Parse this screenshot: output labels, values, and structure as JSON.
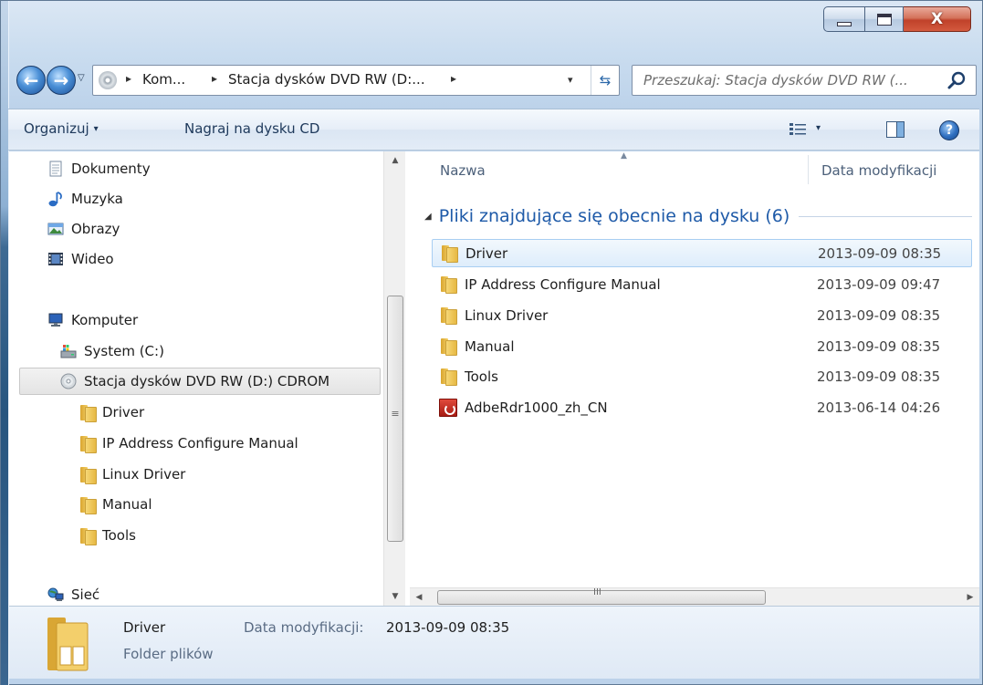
{
  "window": {
    "close_glyph": "X"
  },
  "nav": {
    "back_glyph": "←",
    "forward_glyph": "→",
    "history_caret": "▽"
  },
  "address": {
    "segments": [
      "Kom...",
      "Stacja dysków DVD RW (D:..."
    ],
    "separator": "▸",
    "dropdown_glyph": "▾",
    "refresh_glyph": "⇆"
  },
  "search": {
    "placeholder": "Przeszukaj: Stacja dysków DVD RW (..."
  },
  "toolbar": {
    "organize_label": "Organizuj",
    "organize_caret": "▾",
    "burn_label": "Nagraj na dysku CD",
    "help_glyph": "?"
  },
  "navpane": {
    "items": [
      {
        "label": "Dokumenty",
        "icon": "documents-icon"
      },
      {
        "label": "Muzyka",
        "icon": "music-icon"
      },
      {
        "label": "Obrazy",
        "icon": "pictures-icon"
      },
      {
        "label": "Wideo",
        "icon": "video-icon"
      },
      {
        "label": "Komputer",
        "icon": "computer-icon"
      },
      {
        "label": "System (C:)",
        "icon": "drive-icon"
      },
      {
        "label": "Stacja dysków DVD RW (D:) CDROM",
        "icon": "dvd-drive-icon",
        "selected": true
      },
      {
        "label": "Driver",
        "icon": "folder-icon"
      },
      {
        "label": "IP Address Configure Manual",
        "icon": "folder-icon"
      },
      {
        "label": "Linux Driver",
        "icon": "folder-icon"
      },
      {
        "label": "Manual",
        "icon": "folder-icon"
      },
      {
        "label": "Tools",
        "icon": "folder-icon"
      },
      {
        "label": "Sieć",
        "icon": "network-icon"
      }
    ],
    "scroll_up_glyph": "▲",
    "scroll_down_glyph": "▼",
    "grip_glyph": "≡"
  },
  "content": {
    "columns": {
      "name": "Nazwa",
      "date": "Data modyfikacji",
      "sort_glyph": "▲"
    },
    "group": {
      "caret": "◢",
      "label": "Pliki znajdujące się obecnie na dysku (6)"
    },
    "files": [
      {
        "name": "Driver",
        "date": "2013-09-09 08:35",
        "icon": "folder-icon",
        "selected": true
      },
      {
        "name": "IP Address Configure Manual",
        "date": "2013-09-09 09:47",
        "icon": "folder-icon"
      },
      {
        "name": "Linux Driver",
        "date": "2013-09-09 08:35",
        "icon": "folder-icon"
      },
      {
        "name": "Manual",
        "date": "2013-09-09 08:35",
        "icon": "folder-icon"
      },
      {
        "name": "Tools",
        "date": "2013-09-09 08:35",
        "icon": "folder-icon"
      },
      {
        "name": "AdbeRdr1000_zh_CN",
        "date": "2013-06-14 04:26",
        "icon": "pdf-icon"
      }
    ],
    "hscroll": {
      "left_glyph": "◀",
      "right_glyph": "▶",
      "grip_glyph": "III"
    }
  },
  "details": {
    "name": "Driver",
    "modified_key": "Data modyfikacji:",
    "modified_value": "2013-09-09 08:35",
    "type": "Folder plików"
  }
}
